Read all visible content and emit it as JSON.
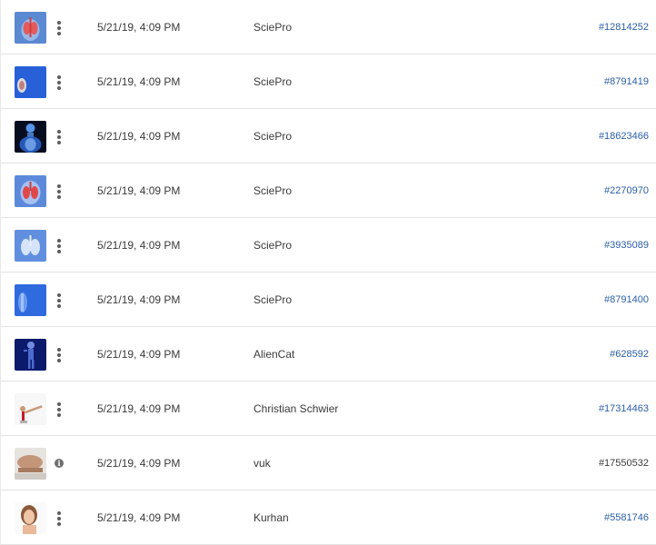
{
  "rows": [
    {
      "thumbnail": "anatomy-organs-thumbnail",
      "date": "5/21/19, 4:09 PM",
      "author": "SciePro",
      "id": "#12814252",
      "action": "more-icon"
    },
    {
      "thumbnail": "blue-joint-thumbnail",
      "date": "5/21/19, 4:09 PM",
      "author": "SciePro",
      "id": "#8791419",
      "action": "more-icon"
    },
    {
      "thumbnail": "xray-skeleton-thumbnail",
      "date": "5/21/19, 4:09 PM",
      "author": "SciePro",
      "id": "#18623466",
      "action": "more-icon"
    },
    {
      "thumbnail": "lungs-red-thumbnail",
      "date": "5/21/19, 4:09 PM",
      "author": "SciePro",
      "id": "#2270970",
      "action": "more-icon"
    },
    {
      "thumbnail": "lungs-blue-thumbnail",
      "date": "5/21/19, 4:09 PM",
      "author": "SciePro",
      "id": "#3935089",
      "action": "more-icon"
    },
    {
      "thumbnail": "blue-body-thumbnail",
      "date": "5/21/19, 4:09 PM",
      "author": "SciePro",
      "id": "#8791400",
      "action": "more-icon"
    },
    {
      "thumbnail": "dark-skeleton-thumbnail",
      "date": "5/21/19, 4:09 PM",
      "author": "AlienCat",
      "id": "#628592",
      "action": "more-icon"
    },
    {
      "thumbnail": "gymnast-thumbnail",
      "date": "5/21/19, 4:09 PM",
      "author": "Christian Schwier",
      "id": "#17314463",
      "action": "more-icon"
    },
    {
      "thumbnail": "arm-muscle-thumbnail",
      "date": "5/21/19, 4:09 PM",
      "author": "vuk",
      "id": "#17550532",
      "action": "info-icon"
    },
    {
      "thumbnail": "woman-portrait-thumbnail",
      "date": "5/21/19, 4:09 PM",
      "author": "Kurhan",
      "id": "#5581746",
      "action": "more-icon"
    }
  ]
}
